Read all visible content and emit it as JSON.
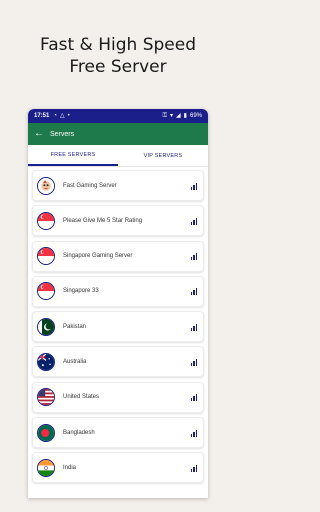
{
  "promo": {
    "title_line1": "Fast & High Speed",
    "title_line2": "Free Server"
  },
  "statusbar": {
    "time": "17:51",
    "battery": "69%"
  },
  "appbar": {
    "title": "Servers"
  },
  "tabs": [
    {
      "label": "FREE SERVERS",
      "active": true
    },
    {
      "label": "VIP SERVERS",
      "active": false
    }
  ],
  "servers": [
    {
      "label": "Fast Gaming Server",
      "icon": "gaming-icon"
    },
    {
      "label": "Please Give Me 5 Star Rating",
      "icon": "singapore-flag-icon"
    },
    {
      "label": "Singapore Gaming Server",
      "icon": "singapore-flag-icon"
    },
    {
      "label": "Singapore 33",
      "icon": "singapore-flag-icon"
    },
    {
      "label": "Pakistan",
      "icon": "pakistan-flag-icon"
    },
    {
      "label": "Australia",
      "icon": "australia-flag-icon"
    },
    {
      "label": "United States",
      "icon": "us-flag-icon"
    },
    {
      "label": "Bangladesh",
      "icon": "bangladesh-flag-icon"
    },
    {
      "label": "India",
      "icon": "india-flag-icon"
    }
  ],
  "colors": {
    "primary": "#1b1f8a",
    "appbar": "#1e7a4a",
    "background": "#f3f0ec"
  }
}
